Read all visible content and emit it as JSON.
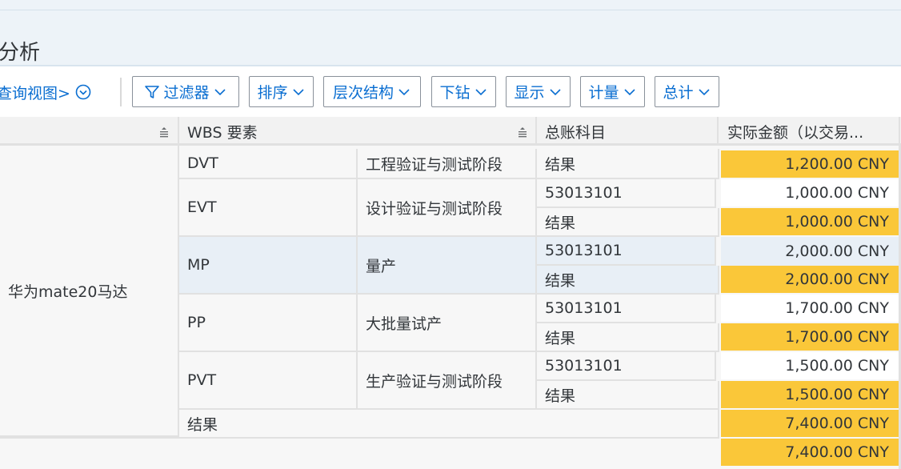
{
  "page": {
    "title": "分析"
  },
  "toolbar": {
    "view_label": "查询视图>",
    "buttons": [
      {
        "label": "过滤器",
        "icon": "filter-icon"
      },
      {
        "label": "排序"
      },
      {
        "label": "层次结构"
      },
      {
        "label": "下钻"
      },
      {
        "label": "显示"
      },
      {
        "label": "计量"
      },
      {
        "label": "总计"
      }
    ]
  },
  "table": {
    "headers": {
      "wbs": "WBS 要素",
      "account": "总账科目",
      "amount": "实际金额（以交易..."
    },
    "project": "华为mate20马达",
    "rows": [
      {
        "code": "DVT",
        "name": "工程验证与测试阶段",
        "entries": [
          {
            "account": "结果",
            "amount": "1,200.00 CNY",
            "type": "total"
          }
        ]
      },
      {
        "code": "EVT",
        "name": "设计验证与测试阶段",
        "entries": [
          {
            "account": "53013101",
            "amount": "1,000.00 CNY",
            "type": "plain"
          },
          {
            "account": "结果",
            "amount": "1,000.00 CNY",
            "type": "total"
          }
        ]
      },
      {
        "code": "MP",
        "name": "量产",
        "entries": [
          {
            "account": "53013101",
            "amount": "2,000.00 CNY",
            "type": "sel"
          },
          {
            "account": "结果",
            "amount": "2,000.00 CNY",
            "type": "total"
          }
        ]
      },
      {
        "code": "PP",
        "name": "大批量试产",
        "entries": [
          {
            "account": "53013101",
            "amount": "1,700.00 CNY",
            "type": "plain"
          },
          {
            "account": "结果",
            "amount": "1,700.00 CNY",
            "type": "total"
          }
        ]
      },
      {
        "code": "PVT",
        "name": "生产验证与测试阶段",
        "entries": [
          {
            "account": "53013101",
            "amount": "1,500.00 CNY",
            "type": "plain"
          },
          {
            "account": "结果",
            "amount": "1,500.00 CNY",
            "type": "total"
          }
        ]
      }
    ],
    "project_result": {
      "label": "结果",
      "amount": "7,400.00 CNY"
    },
    "grand_total": {
      "amount": "7,400.00 CNY"
    }
  },
  "colors": {
    "accent": "#0a6ed1",
    "total": "#fac739",
    "selected": "#e8eff6"
  }
}
